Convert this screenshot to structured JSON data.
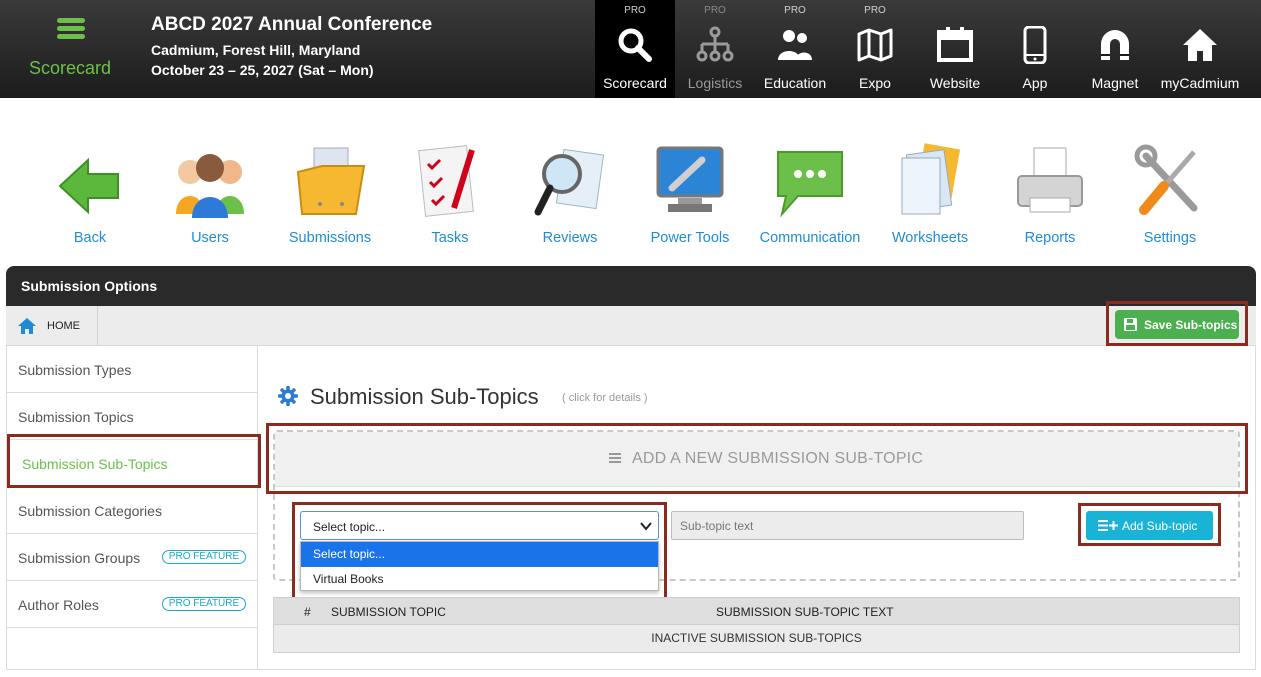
{
  "brand": {
    "label": "Scorecard",
    "accent": "#6cc04a"
  },
  "conference": {
    "title": "ABCD 2027 Annual Conference",
    "location": "Cadmium, Forest Hill, Maryland",
    "dates": "October 23 – 25, 2027 (Sat – Mon)"
  },
  "nav": [
    {
      "label": "Scorecard",
      "pro": "PRO",
      "icon": "search-icon"
    },
    {
      "label": "Logistics",
      "pro": "PRO",
      "icon": "org-chart-icon"
    },
    {
      "label": "Education",
      "pro": "PRO",
      "icon": "people-icon"
    },
    {
      "label": "Expo",
      "pro": "PRO",
      "icon": "map-icon"
    },
    {
      "label": "Website",
      "pro": "",
      "icon": "calendar-icon"
    },
    {
      "label": "App",
      "pro": "",
      "icon": "phone-icon"
    },
    {
      "label": "Magnet",
      "pro": "",
      "icon": "magnet-icon"
    },
    {
      "label": "myCadmium",
      "pro": "",
      "icon": "home-icon"
    }
  ],
  "tools": [
    {
      "label": "Back",
      "icon": "back-arrow-icon"
    },
    {
      "label": "Users",
      "icon": "users-icon"
    },
    {
      "label": "Submissions",
      "icon": "folder-icon"
    },
    {
      "label": "Tasks",
      "icon": "checklist-icon"
    },
    {
      "label": "Reviews",
      "icon": "magnifier-icon"
    },
    {
      "label": "Power Tools",
      "icon": "wrench-monitor-icon"
    },
    {
      "label": "Communication",
      "icon": "chat-bubble-icon"
    },
    {
      "label": "Worksheets",
      "icon": "documents-icon"
    },
    {
      "label": "Reports",
      "icon": "printer-icon"
    },
    {
      "label": "Settings",
      "icon": "tools-icon"
    }
  ],
  "panel": {
    "title": "Submission Options",
    "breadcrumb": "HOME",
    "save_label": "Save Sub-topics"
  },
  "sidebar": {
    "items": [
      {
        "label": "Submission Types",
        "badge": ""
      },
      {
        "label": "Submission Topics",
        "badge": ""
      },
      {
        "label": "Submission Sub-Topics",
        "badge": ""
      },
      {
        "label": "Submission Categories",
        "badge": ""
      },
      {
        "label": "Submission Groups",
        "badge": "PRO FEATURE"
      },
      {
        "label": "Author Roles",
        "badge": "PRO FEATURE"
      }
    ]
  },
  "main": {
    "title": "Submission Sub-Topics",
    "details_hint": "( click for details )",
    "add_new_label": "ADD A NEW SUBMISSION SUB-TOPIC",
    "topic_select": {
      "value": "Select topic...",
      "options": [
        "Select topic...",
        "Virtual Books"
      ]
    },
    "subtopic_placeholder": "Sub-topic text",
    "add_button": "Add Sub-topic",
    "table": {
      "columns": [
        "#",
        "SUBMISSION TOPIC",
        "SUBMISSION SUB-TOPIC TEXT"
      ],
      "inactive_label": "INACTIVE SUBMISSION SUB-TOPICS"
    }
  },
  "colors": {
    "link_blue": "#1f8dd6",
    "save_green": "#4caf50",
    "add_cyan": "#19b3d6",
    "highlight": "#8b2a1e"
  }
}
